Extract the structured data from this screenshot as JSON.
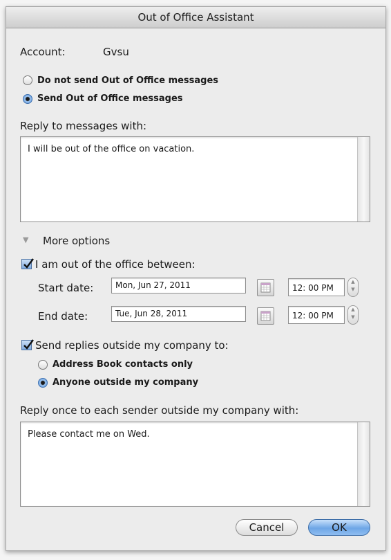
{
  "window": {
    "title": "Out of Office Assistant"
  },
  "account": {
    "label": "Account:",
    "value": "Gvsu"
  },
  "mode": {
    "options": [
      {
        "label": "Do not send Out of Office messages",
        "selected": false
      },
      {
        "label": "Send Out of Office messages",
        "selected": true
      }
    ]
  },
  "reply": {
    "label": "Reply to messages with:",
    "text": "I will be out of the office on vacation."
  },
  "more_options": {
    "label": "More options"
  },
  "out_of_office": {
    "label": "I am out of the office between:",
    "checked": true,
    "start_label": "Start date:",
    "start_date": "Mon, Jun 27, 2011",
    "start_time": "12: 00 PM",
    "end_label": "End date:",
    "end_date": "Tue, Jun 28, 2011",
    "end_time": "12: 00 PM"
  },
  "external": {
    "label": "Send replies outside my company to:",
    "checked": true,
    "options": [
      {
        "label": "Address Book contacts only",
        "selected": false
      },
      {
        "label": "Anyone outside my company",
        "selected": true
      }
    ],
    "reply_label": "Reply once to each sender outside my company with:",
    "reply_text": "Please contact me on Wed."
  },
  "buttons": {
    "cancel": "Cancel",
    "ok": "OK"
  },
  "colors": {
    "accent": "#5d94d8",
    "window_bg": "#ececec"
  }
}
